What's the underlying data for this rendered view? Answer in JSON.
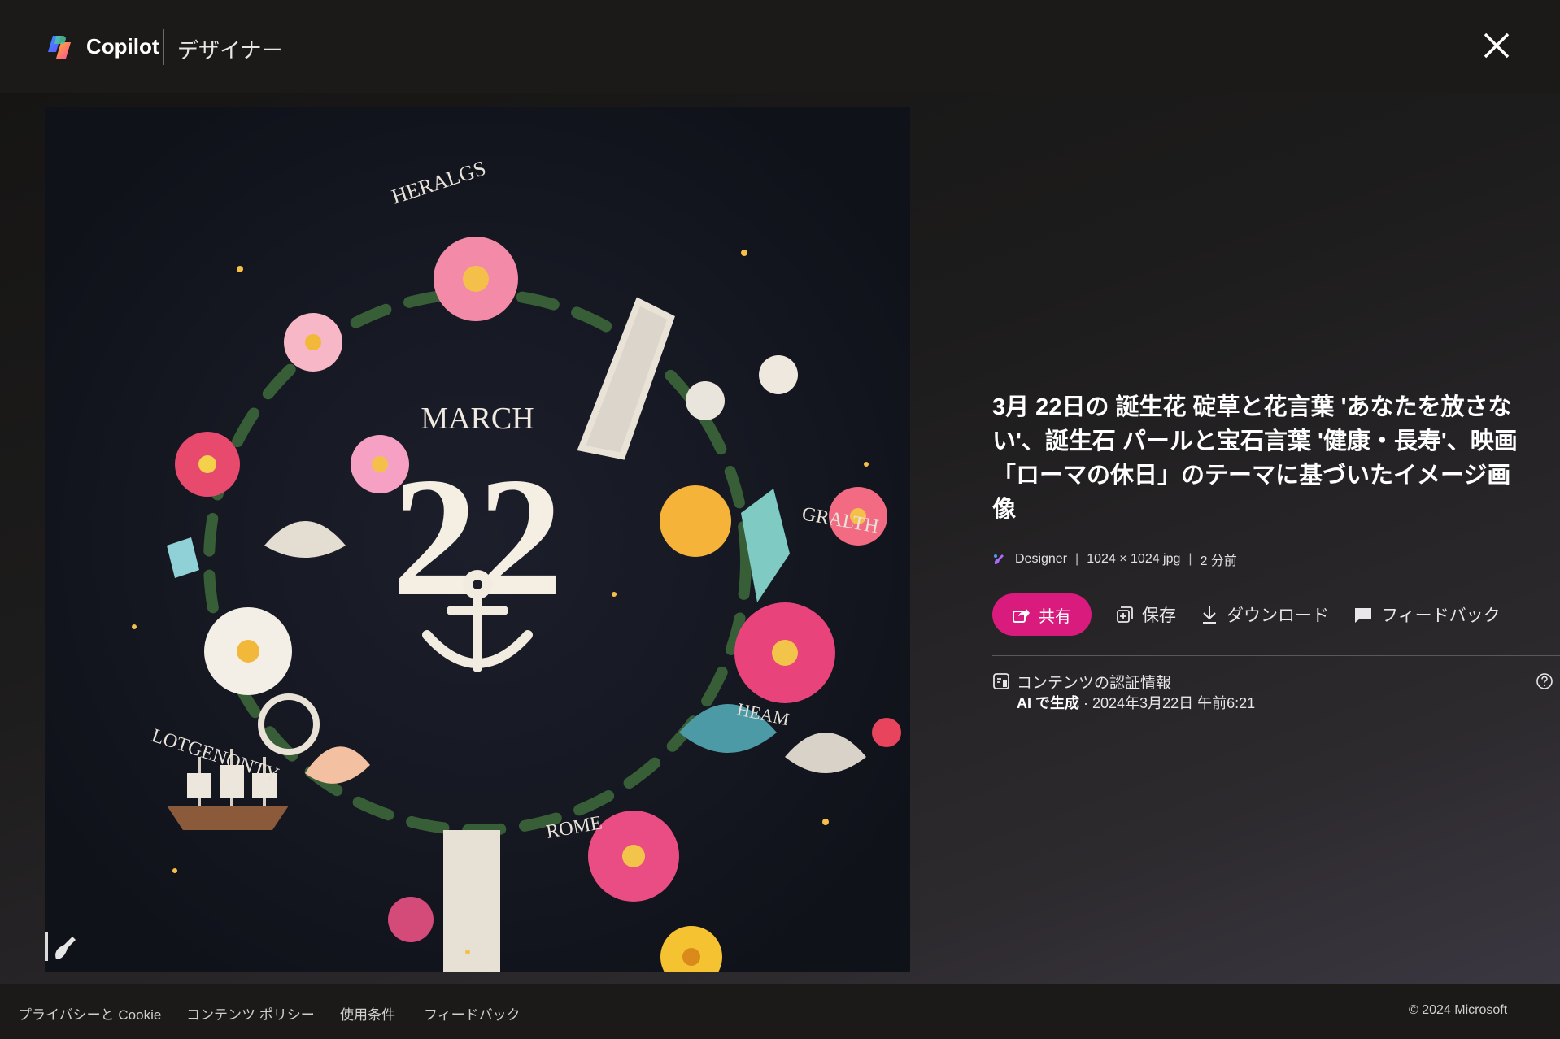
{
  "header": {
    "brand": "Copilot",
    "product": "デザイナー"
  },
  "image": {
    "heading": "MARCH",
    "day": "22",
    "word_top": "HERALGS",
    "word_right": "GRALTH",
    "word_left": "LOTGENONTY",
    "word_bottom": "ROME",
    "word_heam": "HEAM"
  },
  "details": {
    "title": "3月 22日の 誕生花 碇草と花言葉 'あなたを放さない'、誕生石 パールと宝石言葉 '健康・長寿'、映画「ローマの休日」のテーマに基づいたイメージ画像",
    "meta": {
      "source": "Designer",
      "size": "1024 × 1024 jpg",
      "age": "2 分前"
    },
    "actions": {
      "share": "共有",
      "save": "保存",
      "download": "ダウンロード",
      "feedback": "フィードバック"
    },
    "credentials": {
      "title": "コンテンツの認証情報",
      "generated": "AI で生成",
      "date": " · 2024年3月22日 午前6:21"
    }
  },
  "footer": {
    "privacy": "プライバシーと Cookie",
    "policy": "コンテンツ ポリシー",
    "terms": "使用条件",
    "feedback": "フィードバック",
    "copyright": "© 2024 Microsoft"
  },
  "colors": {
    "accent": "#d81b7d",
    "background": "#1b1a19"
  }
}
